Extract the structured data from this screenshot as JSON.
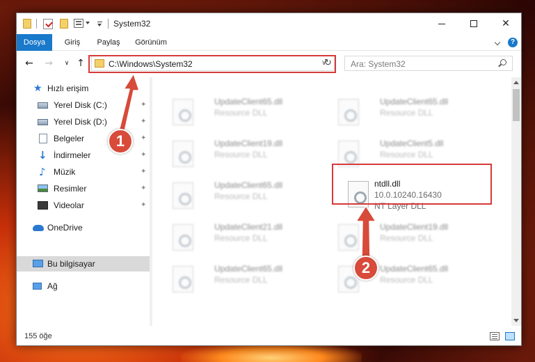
{
  "window": {
    "title": "System32",
    "controls": {
      "minimize": "—",
      "maximize": "☐",
      "close": "✕"
    }
  },
  "ribbon": {
    "tabs": [
      "Dosya",
      "Giriş",
      "Paylaş",
      "Görünüm"
    ],
    "help": "?"
  },
  "navigation": {
    "back": "←",
    "forward": "→",
    "recent": "∨",
    "up": "↑",
    "address": "C:\\Windows\\System32",
    "dropdown": "∨",
    "refresh": "↻",
    "search_placeholder": "Ara: System32"
  },
  "sidebar": {
    "items": [
      {
        "label": "Hızlı erişim",
        "icon": "star-icon",
        "pinned": false
      },
      {
        "label": "Yerel Disk (C:)",
        "icon": "drive-icon",
        "pinned": true
      },
      {
        "label": "Yerel Disk (D:)",
        "icon": "drive-icon",
        "pinned": true
      },
      {
        "label": "Belgeler",
        "icon": "document-icon",
        "pinned": true
      },
      {
        "label": "İndirmeler",
        "icon": "download-icon",
        "pinned": true
      },
      {
        "label": "Müzik",
        "icon": "music-icon",
        "pinned": true
      },
      {
        "label": "Resimler",
        "icon": "picture-icon",
        "pinned": true
      },
      {
        "label": "Videolar",
        "icon": "video-icon",
        "pinned": true
      },
      {
        "label": "OneDrive",
        "icon": "cloud-icon",
        "pinned": false
      },
      {
        "label": "Bu bilgisayar",
        "icon": "computer-icon",
        "pinned": false,
        "selected": true
      },
      {
        "label": "Ağ",
        "icon": "network-icon",
        "pinned": false
      }
    ],
    "pin_glyph": "📌"
  },
  "files": {
    "items": [
      {
        "name": "UpdateClient65.dll",
        "type": "Resource DLL",
        "blurred": true
      },
      {
        "name": "UpdateClient65.dll",
        "type": "Resource DLL",
        "blurred": true
      },
      {
        "name": "UpdateClient19.dll",
        "type": "Resource DLL",
        "blurred": true
      },
      {
        "name": "UpdateClient5.dll",
        "type": "Resource DLL",
        "blurred": true
      },
      {
        "name": "UpdateClient65.dll",
        "type": "Resource DLL",
        "blurred": true
      },
      {
        "name": "ntdll.dll",
        "version": "10.0.10240.16430",
        "type": "NT Layer DLL",
        "blurred": false
      },
      {
        "name": "UpdateClient21.dll",
        "type": "Resource DLL",
        "blurred": true
      },
      {
        "name": "UpdateClient19.dll",
        "type": "Resource DLL",
        "blurred": true
      },
      {
        "name": "UpdateClient65.dll",
        "type": "Resource DLL",
        "blurred": true
      },
      {
        "name": "UpdateClient65.dll",
        "type": "Resource DLL",
        "blurred": true
      }
    ]
  },
  "status": {
    "item_count": "155 öğe"
  },
  "annotations": {
    "step1": "1",
    "step2": "2",
    "color": "#d63a3a"
  },
  "colors": {
    "accent": "#1979ca",
    "annotation": "#d63a3a"
  }
}
